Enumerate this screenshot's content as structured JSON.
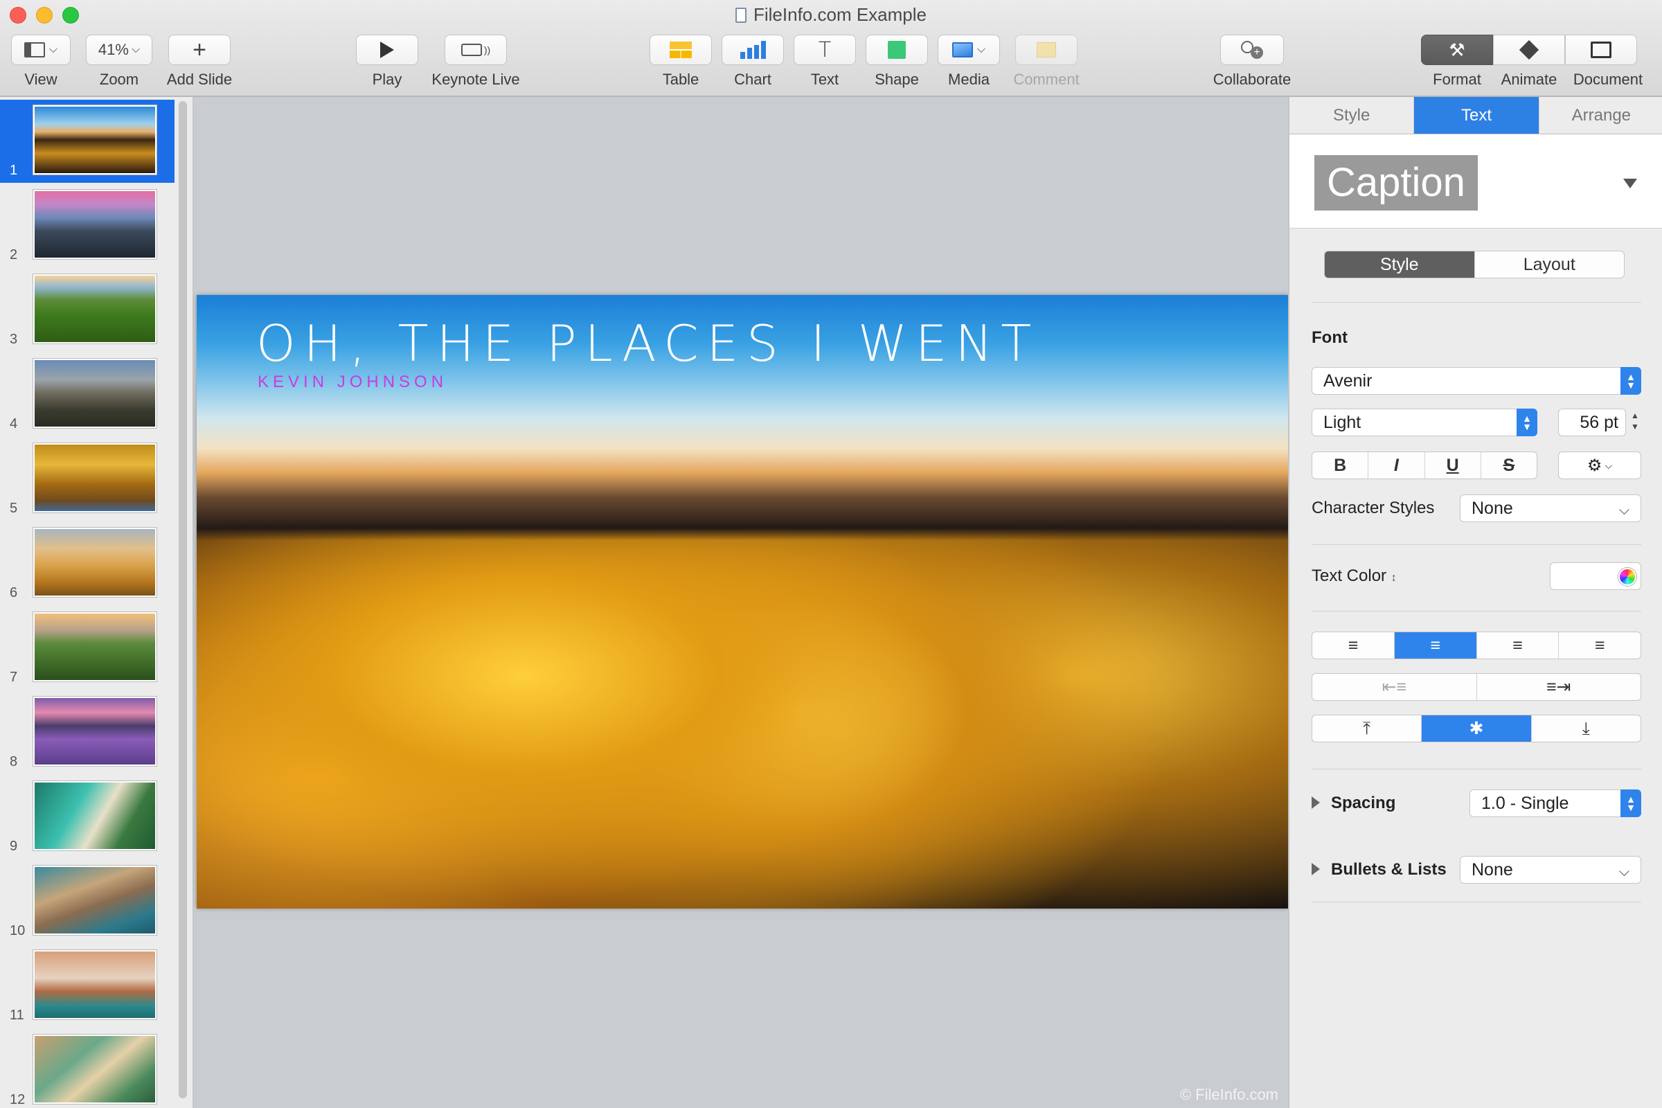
{
  "window": {
    "title": "FileInfo.com Example"
  },
  "toolbar": {
    "view_label": "View",
    "zoom_value": "41%",
    "zoom_label": "Zoom",
    "add_slide_label": "Add Slide",
    "play_label": "Play",
    "keynote_live_label": "Keynote Live",
    "table_label": "Table",
    "chart_label": "Chart",
    "text_label": "Text",
    "shape_label": "Shape",
    "media_label": "Media",
    "comment_label": "Comment",
    "collaborate_label": "Collaborate",
    "format_label": "Format",
    "animate_label": "Animate",
    "document_label": "Document"
  },
  "navigator": {
    "slides": [
      {
        "num": "1",
        "selected": true
      },
      {
        "num": "2"
      },
      {
        "num": "3"
      },
      {
        "num": "4"
      },
      {
        "num": "5"
      },
      {
        "num": "6"
      },
      {
        "num": "7"
      },
      {
        "num": "8"
      },
      {
        "num": "9"
      },
      {
        "num": "10"
      },
      {
        "num": "11"
      },
      {
        "num": "12"
      }
    ]
  },
  "slide": {
    "title": "OH, THE PLACES I WENT",
    "subtitle": "KEVIN JOHNSON",
    "watermark": "© FileInfo.com"
  },
  "inspector": {
    "tabs": [
      "Style",
      "Text",
      "Arrange"
    ],
    "active_tab": "Text",
    "paragraph_style": "Caption",
    "subtabs": [
      "Style",
      "Layout"
    ],
    "font_section": "Font",
    "font_family": "Avenir",
    "font_typeface": "Light",
    "font_size": "56 pt",
    "bold": "B",
    "italic": "I",
    "underline": "U",
    "strike": "S",
    "character_styles_label": "Character Styles",
    "character_styles_value": "None",
    "text_color_label": "Text Color",
    "spacing_label": "Spacing",
    "spacing_value": "1.0 - Single",
    "bullets_label": "Bullets & Lists",
    "bullets_value": "None"
  },
  "colors": {
    "accent": "#2f84ec",
    "selection": "#1b6ee8",
    "subtitle": "#c93ce0"
  }
}
